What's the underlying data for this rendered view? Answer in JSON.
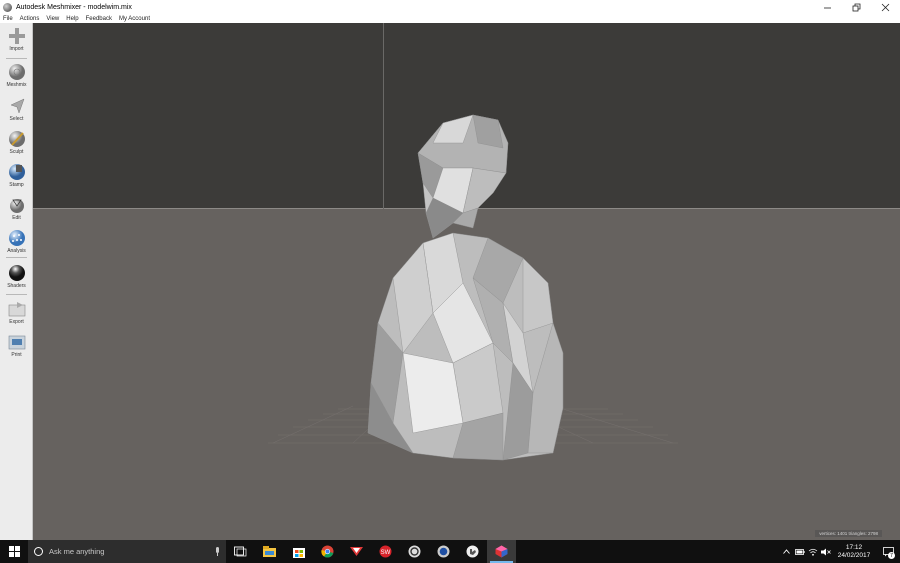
{
  "window": {
    "title": "Autodesk Meshmixer - modelwim.mix",
    "controls": [
      "minimize",
      "restore",
      "close"
    ]
  },
  "menu": [
    "File",
    "Actions",
    "View",
    "Help",
    "Feedback",
    "My Account"
  ],
  "toolbar": {
    "tools": [
      {
        "label": "Import",
        "icon": "import-plus-icon"
      },
      {
        "label": "Meshmix",
        "icon": "meshmix-sphere-icon"
      },
      {
        "label": "Select",
        "icon": "select-arrow-icon"
      },
      {
        "label": "Sculpt",
        "icon": "sculpt-brush-icon"
      },
      {
        "label": "Stamp",
        "icon": "stamp-icon"
      },
      {
        "label": "Edit",
        "icon": "edit-icon"
      },
      {
        "label": "Analysis",
        "icon": "analysis-sphere-icon"
      },
      {
        "label": "Shaders",
        "icon": "shaders-sphere-icon"
      },
      {
        "label": "Export",
        "icon": "export-folder-icon"
      },
      {
        "label": "Print",
        "icon": "print-icon"
      }
    ]
  },
  "viewport": {
    "stats": "vertices: 1401 triangles: 2798",
    "colors": {
      "sky": "#3c3b39",
      "ground": "#66625f",
      "model": "#b9b9b9"
    }
  },
  "taskbar": {
    "search_placeholder": "Ask me anything",
    "apps": [
      "task-view-icon",
      "file-explorer-icon",
      "store-icon",
      "chrome-icon",
      "vivaldi-icon",
      "solidworks-icon",
      "app-c-icon",
      "app-blue-circle-icon",
      "app-hand-icon",
      "meshmixer-icon"
    ],
    "active_app": "meshmixer-icon",
    "tray": {
      "time": "17:12",
      "date": "24/02/2017",
      "notification_count": "7"
    }
  }
}
